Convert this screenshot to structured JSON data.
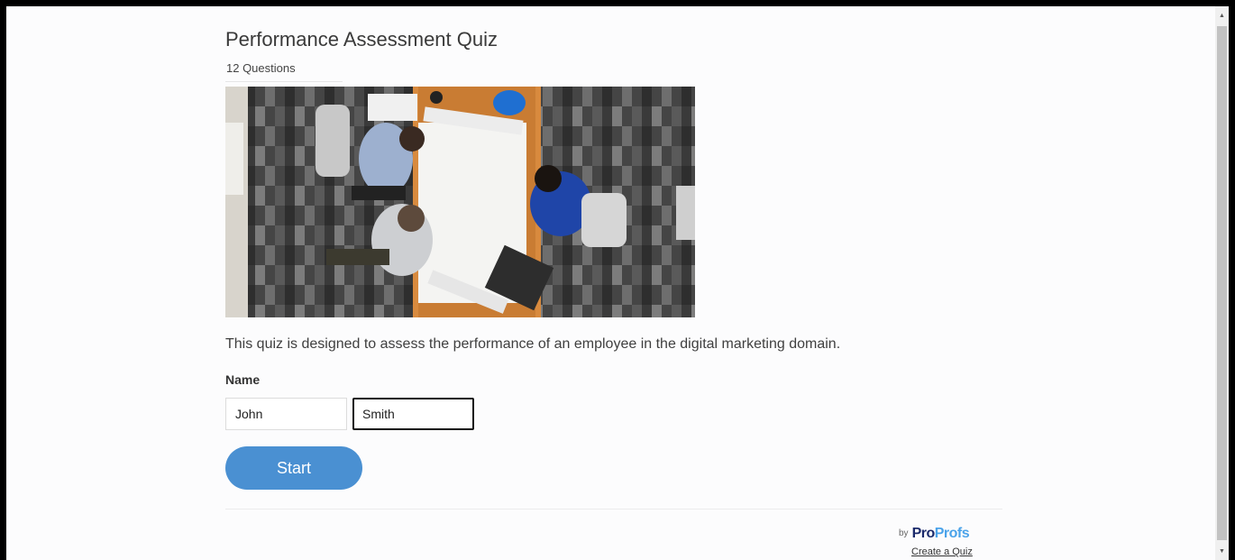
{
  "quiz": {
    "title": "Performance Assessment Quiz",
    "question_count": "12 Questions",
    "description": "This quiz is designed to assess the performance of an employee in the digital marketing domain."
  },
  "form": {
    "name_label": "Name",
    "first_name_value": "John",
    "last_name_value": "Smith",
    "start_label": "Start"
  },
  "footer": {
    "by": "by",
    "brand_pro": "Pro",
    "brand_profs": "Profs",
    "create_link": "Create a Quiz"
  },
  "colors": {
    "start_button": "#4a90d2",
    "brand_dark": "#1b2a6b",
    "brand_light": "#4aa3ea"
  },
  "icons": {
    "scroll_up": "triangle-up-icon",
    "scroll_down": "triangle-down-icon"
  }
}
